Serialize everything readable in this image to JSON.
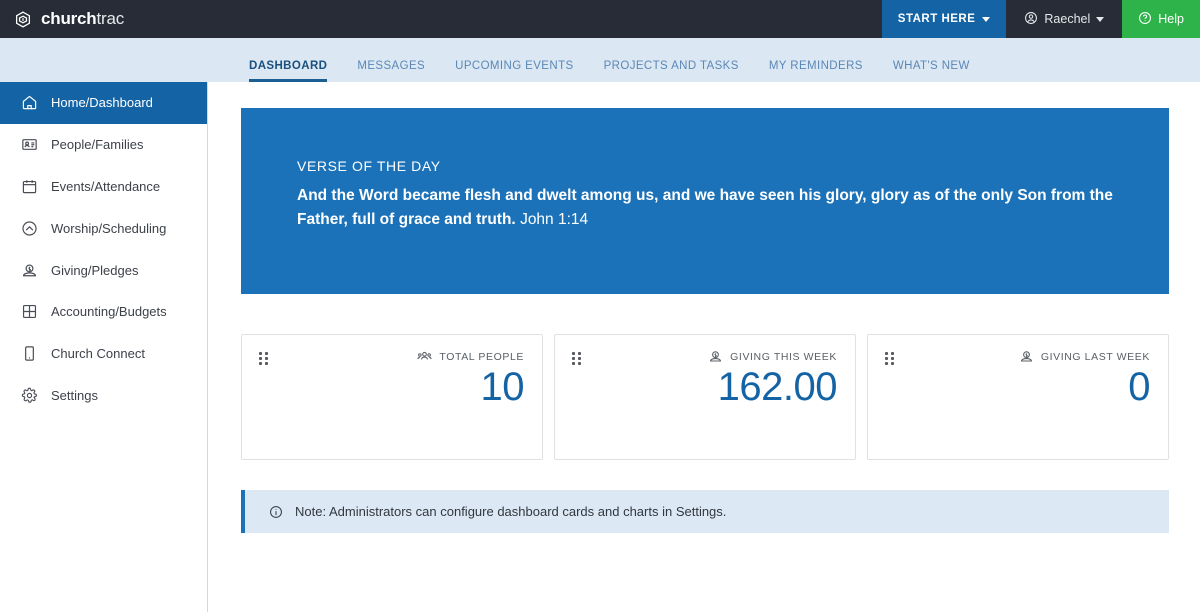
{
  "topbar": {
    "brand_bold": "church",
    "brand_light": "trac",
    "brand_icon": "hexagon-logo-icon",
    "start_here_label": "START HERE",
    "user_name": "Raechel",
    "user_icon": "user-circle-icon",
    "help_label": "Help",
    "help_icon": "question-circle-icon",
    "caret_icon": "caret-down-icon",
    "bg_color": "#272c36",
    "start_here_color": "#1464a5",
    "help_color": "#2eb34a"
  },
  "subnav": {
    "bg_color": "#dbe8f4",
    "active_color": "#1b5e91",
    "items": [
      {
        "label": "DASHBOARD",
        "active": true
      },
      {
        "label": "MESSAGES",
        "active": false
      },
      {
        "label": "UPCOMING EVENTS",
        "active": false
      },
      {
        "label": "PROJECTS AND TASKS",
        "active": false
      },
      {
        "label": "MY REMINDERS",
        "active": false
      },
      {
        "label": "WHAT'S NEW",
        "active": false
      }
    ]
  },
  "sidebar": {
    "active_color": "#1464a5",
    "items": [
      {
        "label": "Home/Dashboard",
        "icon": "home-icon",
        "active": true
      },
      {
        "label": "People/Families",
        "icon": "id-card-icon",
        "active": false
      },
      {
        "label": "Events/Attendance",
        "icon": "calendar-icon",
        "active": false
      },
      {
        "label": "Worship/Scheduling",
        "icon": "chevron-up-circle-icon",
        "active": false
      },
      {
        "label": "Giving/Pledges",
        "icon": "donation-icon",
        "active": false
      },
      {
        "label": "Accounting/Budgets",
        "icon": "grid-table-icon",
        "active": false
      },
      {
        "label": "Church Connect",
        "icon": "mobile-phone-icon",
        "active": false
      },
      {
        "label": "Settings",
        "icon": "gear-icon",
        "active": false
      }
    ]
  },
  "verse": {
    "label": "VERSE OF THE DAY",
    "text": "And the Word became flesh and dwelt among us, and we have seen his glory, glory as of the only Son from the Father, full of grace and truth.",
    "reference": "John 1:14",
    "bg_color": "#1b72b8"
  },
  "cards": [
    {
      "label": "TOTAL PEOPLE",
      "value": "10",
      "icon": "people-group-icon",
      "handle_icon": "drag-handle-icon"
    },
    {
      "label": "GIVING THIS WEEK",
      "value": "162.00",
      "icon": "donation-icon",
      "handle_icon": "drag-handle-icon"
    },
    {
      "label": "GIVING LAST WEEK",
      "value": "0",
      "icon": "donation-icon",
      "handle_icon": "drag-handle-icon"
    }
  ],
  "note": {
    "icon": "info-circle-icon",
    "text": "Note: Administrators can configure dashboard cards and charts in Settings.",
    "accent_color": "#1b72b8",
    "bg_color": "#dce9f5"
  }
}
